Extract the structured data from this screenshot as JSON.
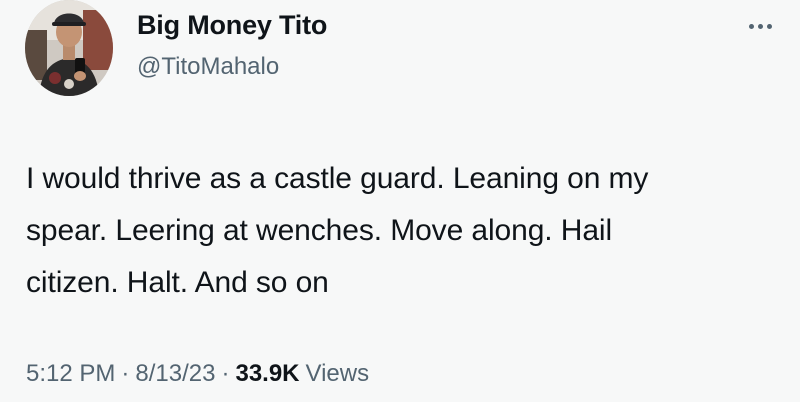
{
  "author": {
    "display_name": "Big Money Tito",
    "handle": "@TitoMahalo",
    "avatar_icon": "profile-photo"
  },
  "tweet": {
    "text_lines": [
      "I would thrive as a castle guard. Leaning on my",
      "spear. Leering at wenches. Move along. Hail",
      "citizen. Halt. And so on"
    ],
    "time": "5:12 PM",
    "date": "8/13/23",
    "separator": "·",
    "views_count": "33.9K",
    "views_label": "Views"
  },
  "menu": {
    "icon": "more-horizontal-icon"
  },
  "colors": {
    "background": "#f7f8f8",
    "text_primary": "#0f1419",
    "text_secondary": "#536471"
  }
}
